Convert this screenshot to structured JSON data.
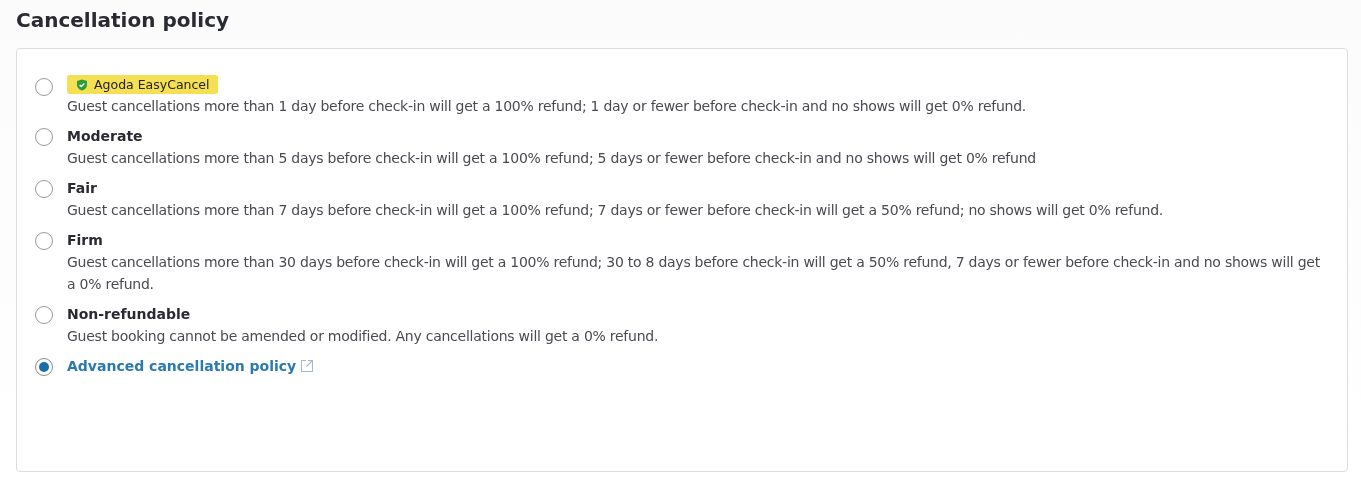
{
  "title": "Cancellation policy",
  "options": [
    {
      "kind": "badge",
      "label": "Agoda EasyCancel",
      "description": "Guest cancellations more than 1 day before check-in will get a 100% refund; 1 day or fewer before check-in and no shows will get 0% refund.",
      "selected": false
    },
    {
      "kind": "plain",
      "label": "Moderate",
      "description": "Guest cancellations more than 5 days before check-in will get a 100% refund; 5 days or fewer before check-in and no shows will get 0% refund",
      "selected": false
    },
    {
      "kind": "plain",
      "label": "Fair",
      "description": "Guest cancellations more than 7 days before check-in will get a 100% refund; 7 days or fewer before check-in will get a 50% refund; no shows will get 0% refund.",
      "selected": false
    },
    {
      "kind": "plain",
      "label": "Firm",
      "description": "Guest cancellations more than 30 days before check-in will get a 100% refund; 30 to 8 days before check-in will get a 50% refund, 7 days or fewer before check-in and no shows will get a 0% refund.",
      "selected": false
    },
    {
      "kind": "plain",
      "label": "Non-refundable",
      "description": "Guest booking cannot be amended or modified. Any cancellations will get a 0% refund.",
      "selected": false
    },
    {
      "kind": "link",
      "label": "Advanced cancellation policy",
      "selected": true
    }
  ]
}
